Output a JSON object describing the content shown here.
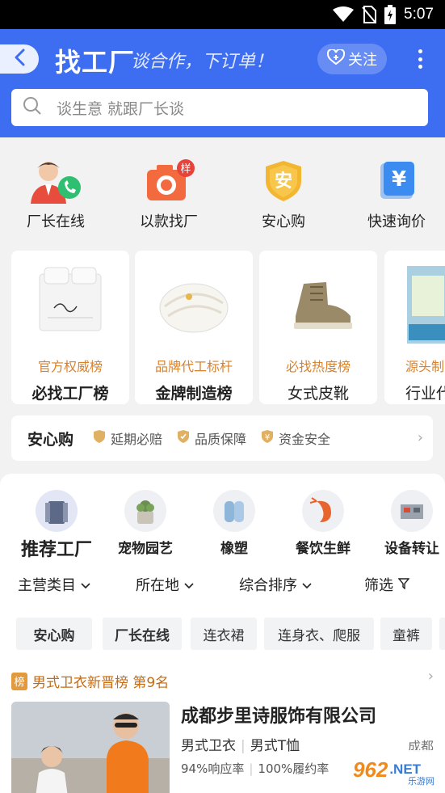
{
  "status_bar": {
    "time": "5:07"
  },
  "header": {
    "brand": "找工厂",
    "slogan": "谈合作，下订单！",
    "follow_label": "关注",
    "search_placeholder": "谈生意 就跟厂长谈"
  },
  "quick_entries": [
    {
      "label": "厂长在线",
      "icon": "manager-phone-icon"
    },
    {
      "label": "以款找厂",
      "icon": "camera-sample-icon",
      "badge": "样"
    },
    {
      "label": "安心购",
      "icon": "shield-an-icon"
    },
    {
      "label": "快速询价",
      "icon": "price-inquiry-icon"
    }
  ],
  "ranking_cards": [
    {
      "subtitle": "官方权威榜",
      "title": "必找工厂榜"
    },
    {
      "subtitle": "品牌代工标杆",
      "title": "金牌制造榜"
    },
    {
      "subtitle": "必找热度榜",
      "title": "女式皮靴"
    },
    {
      "subtitle": "源头制",
      "title": "行业代"
    }
  ],
  "assurance": {
    "logo": "安心购",
    "items": [
      "延期必赔",
      "品质保障",
      "资金安全"
    ]
  },
  "categories": [
    {
      "label": "推荐工厂",
      "active": true
    },
    {
      "label": "宠物园艺"
    },
    {
      "label": "橡塑"
    },
    {
      "label": "餐饮生鲜"
    },
    {
      "label": "设备转让"
    }
  ],
  "filters": [
    "主营类目",
    "所在地",
    "综合排序",
    "筛选"
  ],
  "tags": [
    "安心购",
    "厂长在线",
    "连衣裙",
    "连身衣、爬服",
    "童裤"
  ],
  "featured": {
    "rank_badge": "榜",
    "rank_text": "男式卫衣新晋榜 第9名",
    "company": "成都步里诗服饰有限公司",
    "product_tags": [
      "男式卫衣",
      "男式T恤"
    ],
    "city": "成都",
    "response_rate": "94%响应率",
    "fulfillment_rate": "100%履约率"
  },
  "watermark": {
    "number": "962",
    "suffix": ".NET",
    "sub": "乐游网"
  },
  "colors": {
    "brand_blue": "#3d6ef2",
    "accent_orange": "#d9822b"
  }
}
